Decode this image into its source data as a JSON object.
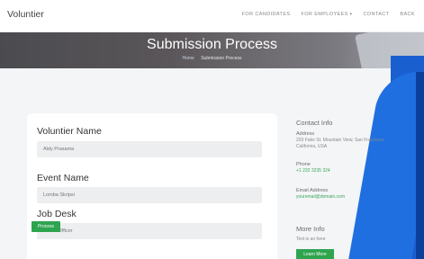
{
  "nav": {
    "brand": "Voluntier",
    "links": [
      "FOR CANDIDATES",
      "FOR EMPLOYEES",
      "CONTACT",
      "BACK"
    ]
  },
  "hero": {
    "title": "Submission Process",
    "crumb_home": "Home",
    "crumb_current": "Submission Process"
  },
  "form": {
    "name_label": "Voluntier Name",
    "name_value": "Aldy Prasama",
    "event_label": "Event Name",
    "event_value": "Lomba Skripsi",
    "job_label": "Job Desk",
    "job_value": "Traffic Officer",
    "process_label": "Process"
  },
  "contact": {
    "heading": "Contact Info",
    "address_label": "Address",
    "address_value": "203 Fake St. Mountain View, San Francisco, California, USA",
    "phone_label": "Phone",
    "phone_value": "+1 232 3235 324",
    "email_label": "Email Address",
    "email_value": "youremail@domain.com",
    "more_heading": "More Info",
    "more_text": "Text is an here",
    "learn_more_label": "Learn More"
  },
  "colors": {
    "accent_green": "#2ea44f",
    "accent_blue": "#1f6fe0"
  }
}
